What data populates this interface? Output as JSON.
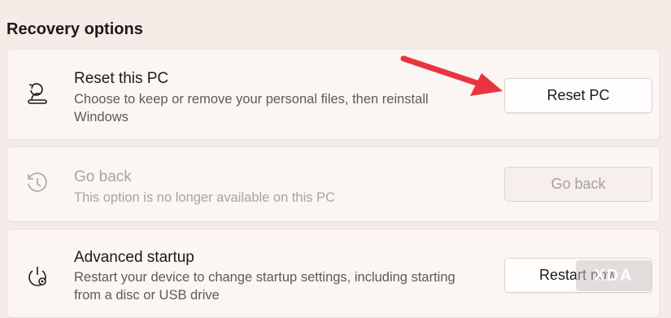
{
  "section": {
    "title": "Recovery options"
  },
  "items": [
    {
      "title": "Reset this PC",
      "description": "Choose to keep or remove your personal files, then reinstall Windows",
      "button": "Reset PC",
      "icon": "reset-pc-icon",
      "enabled": true
    },
    {
      "title": "Go back",
      "description": "This option is no longer available on this PC",
      "button": "Go back",
      "icon": "history-icon",
      "enabled": false
    },
    {
      "title": "Advanced startup",
      "description": "Restart your device to change startup settings, including starting from a disc or USB drive",
      "button": "Restart now",
      "icon": "power-settings-icon",
      "enabled": true
    }
  ],
  "annotation": {
    "arrow_color": "#e8343f",
    "arrow_target": "Reset PC"
  },
  "watermark": {
    "text": "XDA"
  },
  "colors": {
    "background": "#f5ebe7",
    "card": "#fbf5f3",
    "disabled_text": "#a9a3a1"
  }
}
